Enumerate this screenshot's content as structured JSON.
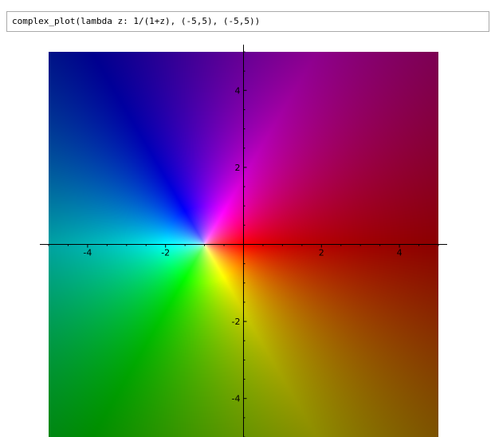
{
  "cell": {
    "input_code": "complex_plot(lambda z: 1/(1+z), (-5,5), (-5,5))"
  },
  "chart_data": {
    "type": "heatmap",
    "function": "1/(1+z)",
    "xlim": [
      -5,
      5
    ],
    "ylim": [
      -5,
      5
    ],
    "x_ticks": [
      -4,
      -2,
      2,
      4
    ],
    "y_ticks": [
      4,
      2,
      -2,
      -4
    ],
    "x_tick_labels": [
      "-4",
      "-2",
      "2",
      "4"
    ],
    "y_tick_labels": [
      "4",
      "2",
      "-2",
      "-4"
    ],
    "pole": {
      "x": -1,
      "y": 0
    },
    "coloring": "hue = argument, brightness = modulus",
    "grid": false,
    "axis_color": "#000000"
  }
}
